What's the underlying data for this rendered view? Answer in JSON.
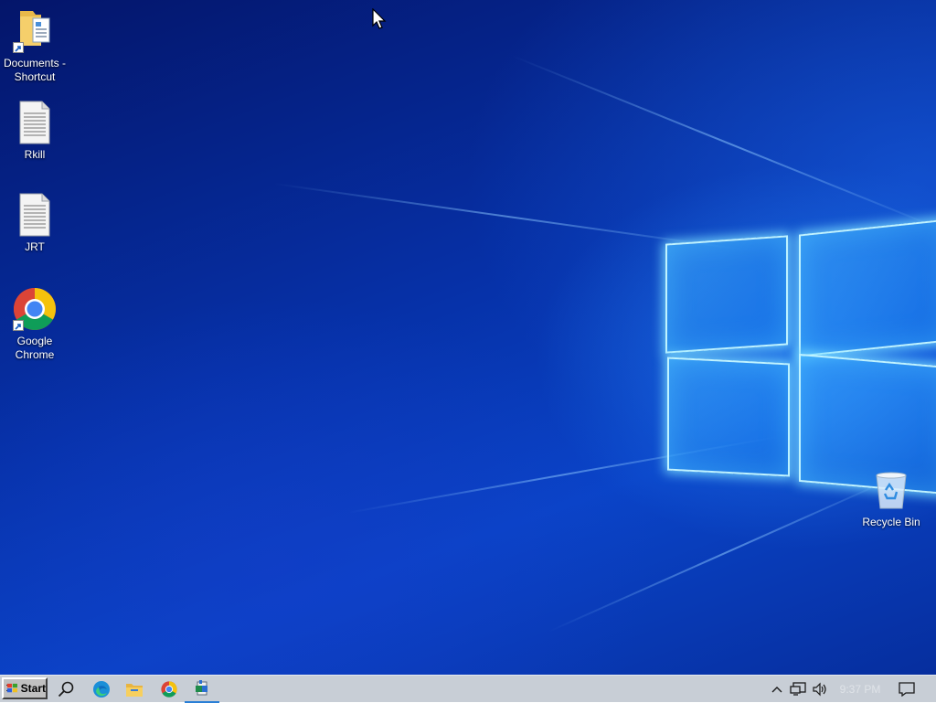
{
  "desktop": {
    "icons": [
      {
        "label": "Documents - Shortcut",
        "icon": "folder-documents-shortcut-icon"
      },
      {
        "label": "Rkill",
        "icon": "text-file-icon"
      },
      {
        "label": "JRT",
        "icon": "text-file-icon"
      },
      {
        "label": "Google Chrome",
        "icon": "chrome-shortcut-icon"
      },
      {
        "label": "Recycle Bin",
        "icon": "recycle-bin-icon"
      }
    ],
    "wallpaper": "windows-10-hero"
  },
  "taskbar": {
    "start_label": "Start",
    "apps": [
      {
        "name": "Search",
        "icon": "search-icon"
      },
      {
        "name": "Microsoft Edge",
        "icon": "edge-icon"
      },
      {
        "name": "File Explorer",
        "icon": "file-explorer-icon"
      },
      {
        "name": "Google Chrome",
        "icon": "chrome-icon"
      },
      {
        "name": "Active program",
        "icon": "setup-app-icon",
        "active": true
      }
    ],
    "tray": {
      "clock": "9:37 PM",
      "icons": [
        "chevron-up-icon",
        "network-icon",
        "volume-icon",
        "notification-icon"
      ]
    }
  },
  "colors": {
    "taskbar": "#c8ced6",
    "active_indicator": "#2a7fd6",
    "wallpaper_glow": "#bff3ff"
  }
}
